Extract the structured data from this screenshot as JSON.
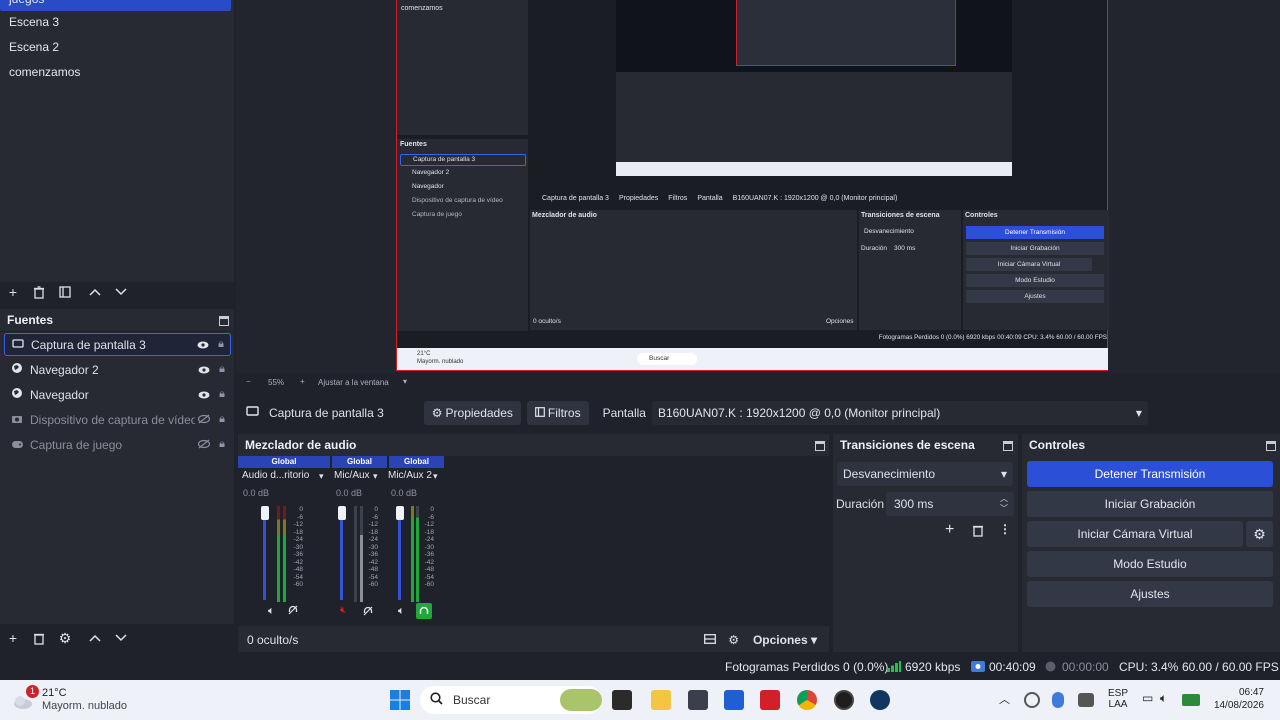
{
  "scenes": {
    "items": [
      {
        "label": "juegos"
      },
      {
        "label": "Escena 3"
      },
      {
        "label": "Escena 2"
      },
      {
        "label": "comenzamos"
      }
    ]
  },
  "sources": {
    "title": "Fuentes",
    "items": [
      {
        "label": "Captura de pantalla 3"
      },
      {
        "label": "Navegador 2"
      },
      {
        "label": "Navegador"
      },
      {
        "label": "Dispositivo de captura de vídeo"
      },
      {
        "label": "Captura de juego"
      }
    ]
  },
  "preview": {
    "nested_scene_label": "comenzamos",
    "nested_sources_title": "Fuentes",
    "nested_sources": [
      "Captura de pantalla 3",
      "Navegador 2",
      "Navegador",
      "Dispositivo de captura de vídeo",
      "Captura de juego"
    ],
    "nested_context_source": "Captura de pantalla 3",
    "nested_props": "Propiedades",
    "nested_filters": "Filtros",
    "nested_screen": "Pantalla",
    "nested_screen_value": "B160UAN07.K : 1920x1200 @ 0,0 (Monitor principal)",
    "nested_mixer_title": "Mezclador de audio",
    "nested_trans_title": "Transiciones de escena",
    "nested_controls_title": "Controles",
    "nested_ctrl": [
      "Detener Transmisión",
      "Iniciar Grabación",
      "Iniciar Cámara Virtual",
      "Modo Estudio",
      "Ajustes"
    ],
    "nested_fade": "Desvanecimiento",
    "nested_duration": "Duración",
    "nested_duration_val": "300 ms",
    "nested_hidden": "0 oculto/s",
    "nested_options": "Opciones",
    "nested_status": "Fotogramas Perdidos 0 (0.0%)   6920 kbps   00:40:09   CPU: 3.4%   60.00 / 60.00 FPS",
    "nested_weather": "21°C",
    "nested_weather_sub": "Mayorm. nublado",
    "nested_search": "Buscar"
  },
  "zoom": {
    "percent": "55%",
    "fit_label": "Ajustar a la ventana"
  },
  "context": {
    "source_name": "Captura de pantalla 3",
    "properties": "Propiedades",
    "filters": "Filtros",
    "screen_label": "Pantalla",
    "screen_value": "B160UAN07.K : 1920x1200 @ 0,0 (Monitor principal)"
  },
  "mixer": {
    "title": "Mezclador de audio",
    "channels": [
      {
        "head": "Global",
        "name": "Audio d...ritorio",
        "db": "0.0 dB",
        "level": 0.85
      },
      {
        "head": "Global",
        "name": "Mic/Aux",
        "db": "0.0 dB",
        "level": 0.85
      },
      {
        "head": "Global",
        "name": "Mic/Aux 2",
        "db": "0.0 dB",
        "level": 0.85
      }
    ],
    "scale": [
      "0",
      "-6",
      "-12",
      "-18",
      "-24",
      "-30",
      "-36",
      "-42",
      "-48",
      "-54",
      "-60"
    ],
    "hidden": "0 oculto/s",
    "options": "Opciones"
  },
  "transitions": {
    "title": "Transiciones de escena",
    "type": "Desvanecimiento",
    "duration_label": "Duración",
    "duration_value": "300 ms"
  },
  "controls": {
    "title": "Controles",
    "stop_stream": "Detener Transmisión",
    "start_record": "Iniciar Grabación",
    "start_vcam": "Iniciar Cámara Virtual",
    "studio": "Modo Estudio",
    "settings": "Ajustes"
  },
  "status": {
    "dropped": "Fotogramas Perdidos 0 (0.0%)",
    "bitrate": "6920 kbps",
    "stream_time": "00:40:09",
    "rec_time": "00:00:00",
    "cpu": "CPU: 3.4%",
    "fps": "60.00 / 60.00 FPS"
  },
  "taskbar": {
    "badge": "1",
    "temp": "21°C",
    "weather": "Mayorm. nublado",
    "search": "Buscar",
    "lang": "ESP",
    "lang_sub": "LAA",
    "time": "06:47",
    "date": "14/08/2026"
  },
  "colors": {
    "accent": "#2c4fd7",
    "live_border": "#d1202a",
    "panel": "#272a33",
    "bg": "#1f212b"
  }
}
